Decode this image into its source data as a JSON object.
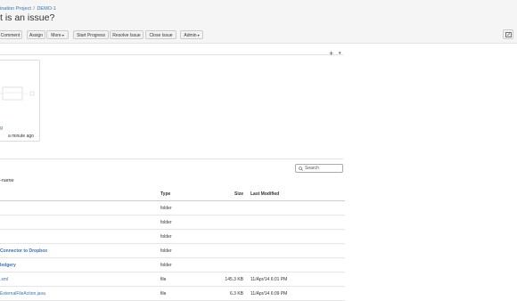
{
  "header": {
    "breadcrumb": [
      "ination Project",
      "DEMO-1"
    ],
    "title": "t is an issue?"
  },
  "toolbar": {
    "buttons": [
      "Comment",
      "Assign",
      "More",
      "Start Progress",
      "Resolve Issue",
      "Close Issue",
      "Admin"
    ]
  },
  "attachment": {
    "name": "g",
    "time": "a minute ago"
  },
  "files": {
    "search_placeholder": "Search",
    "path_label": "-name",
    "columns": [
      "Type",
      "Size",
      "Last Modified"
    ],
    "rows": [
      {
        "name": "",
        "type": "folder",
        "size": "",
        "modified": ""
      },
      {
        "name": "",
        "type": "folder",
        "size": "",
        "modified": ""
      },
      {
        "name": "",
        "type": "folder",
        "size": "",
        "modified": ""
      },
      {
        "name": "Connector to Dropbox",
        "type": "folder",
        "size": "",
        "modified": ""
      },
      {
        "name": "ledgery",
        "type": "folder",
        "size": "",
        "modified": ""
      },
      {
        "name": ".xml",
        "type": "file",
        "size": "145.3 KB",
        "modified": "11/Apr/14 6:01 PM"
      },
      {
        "name": "ExternalFileAction.java",
        "type": "file",
        "size": "6.3 KB",
        "modified": "11/Apr/14 6:09 PM"
      }
    ]
  }
}
